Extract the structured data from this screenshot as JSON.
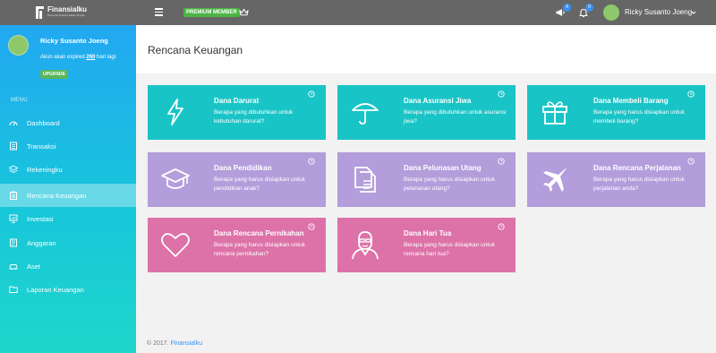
{
  "topbar": {
    "logo_name": "Finansialku",
    "logo_tagline": "Personal Finance Made Simple",
    "premium_label": "PREMIUM MEMBER",
    "notifications": [
      {
        "icon": "megaphone-icon",
        "count": "4"
      },
      {
        "icon": "bell-icon",
        "count": "0"
      }
    ],
    "user_name": "Ricky Susanto Joeng"
  },
  "sidebar": {
    "user_name": "Ricky Susanto Joeng",
    "expiry_prefix": "Akun akan expired ",
    "expiry_days": "260",
    "expiry_suffix": " hari lagi.",
    "upgrade_label": "UPGRADE",
    "menu_label": "MENU",
    "items": [
      {
        "label": "Dashboard",
        "icon": "dashboard-icon"
      },
      {
        "label": "Transaksi",
        "icon": "transaction-icon"
      },
      {
        "label": "Rekeningku",
        "icon": "layers-icon"
      },
      {
        "label": "Rencana Keuangan",
        "icon": "clipboard-icon",
        "active": true
      },
      {
        "label": "Investasi",
        "icon": "presentation-icon"
      },
      {
        "label": "Anggaran",
        "icon": "budget-icon"
      },
      {
        "label": "Aset",
        "icon": "car-icon"
      },
      {
        "label": "Laporan Keuangan",
        "icon": "folder-icon"
      }
    ]
  },
  "main": {
    "title": "Rencana Keuangan",
    "cards": [
      {
        "title": "Dana Darurat",
        "desc": "Berapa yang dibutuhkan untuk kebutuhan darurat?",
        "icon": "lightning-icon"
      },
      {
        "title": "Dana Asuransi Jiwa",
        "desc": "Berapa yang dibutuhkan untuk asuransi jiwa?",
        "icon": "umbrella-icon"
      },
      {
        "title": "Dana Membeli Barang",
        "desc": "Berapa yang harus disiapkan untuk membeli barang?",
        "icon": "gift-icon"
      },
      {
        "title": "Dana Pendidikan",
        "desc": "Berapa yang harus disiapkan untuk pendidikan anak?",
        "icon": "graduation-cap-icon"
      },
      {
        "title": "Dana Pelunasan Utang",
        "desc": "Berapa yang harus disiapkan untuk pelunasan utang?",
        "icon": "documents-icon"
      },
      {
        "title": "Dana Rencana Perjalanan",
        "desc": "Berapa yang harus disiapkan untuk perjalanan anda?",
        "icon": "airplane-icon"
      },
      {
        "title": "Dana Rencana Pernikahan",
        "desc": "Berapa yang harus disiapkan untuk rencana pernikahan?",
        "icon": "heart-icon"
      },
      {
        "title": "Dana Hari Tua",
        "desc": "Berapa yang harus disiapkan untuk rencana hari tua?",
        "icon": "old-man-icon"
      }
    ]
  },
  "footer": {
    "copyright": "© 2017. ",
    "brand": "Finansialku"
  },
  "colors": {
    "teal": "#19c4c6",
    "lilac": "#b39ddb",
    "pink": "#dd72a8",
    "premium_green": "#4bb543",
    "badge_blue": "#3a8ff2"
  }
}
